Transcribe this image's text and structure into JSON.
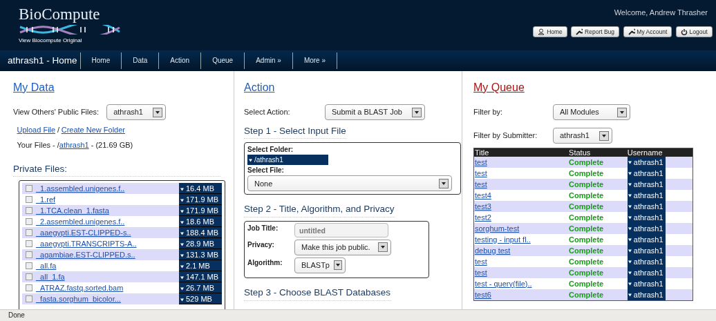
{
  "header": {
    "logo": "BioCompute",
    "original_link": "View Biocompute Original",
    "welcome": "Welcome, Andrew Thrasher",
    "buttons": [
      {
        "label": "Home",
        "kind": "home"
      },
      {
        "label": "Report Bug",
        "kind": "report"
      },
      {
        "label": "My Account",
        "kind": "account"
      },
      {
        "label": "Logout",
        "kind": "logout"
      }
    ]
  },
  "nav": {
    "title": "athrash1 - Home",
    "items": [
      "Home",
      "Data",
      "Action",
      "Queue",
      "Admin »",
      "More »"
    ]
  },
  "my_data": {
    "heading": "My Data",
    "view_label": "View Others' Public Files:",
    "view_value": "athrash1",
    "links": [
      "Upload File",
      "Create New Folder"
    ],
    "link_sep": "/",
    "files_prefix": "Your Files - /",
    "files_folder": "athrash1",
    "files_suffix": " - (21.69 GB)",
    "private_heading": "Private Files:",
    "files": [
      {
        "name": "_1.assembled.unigenes.f..",
        "size": "16.4 MB",
        "checked": false
      },
      {
        "name": "_1.ref",
        "size": "171.9 MB",
        "checked": false
      },
      {
        "name": "_1.TCA.clean_1.fasta",
        "size": "171.9 MB",
        "checked": false
      },
      {
        "name": "_2.assembled.unigenes.f..",
        "size": "18.6 MB",
        "checked": false
      },
      {
        "name": "_aaegypti.EST-CLIPPED-s..",
        "size": "188.4 MB",
        "checked": false
      },
      {
        "name": "_aaegypti.TRANSCRIPTS-A..",
        "size": "28.9 MB",
        "checked": false
      },
      {
        "name": "_agambiae.EST-CLIPPED.s..",
        "size": "131.3 MB",
        "checked": false
      },
      {
        "name": "_all.fa",
        "size": "2.1 MB",
        "checked": false
      },
      {
        "name": "_all_1.fa",
        "size": "147.1 MB",
        "checked": false
      },
      {
        "name": "_ATRAZ.fastq.sorted.bam",
        "size": "26.7 MB",
        "checked": false
      },
      {
        "name": "_fasta.sorghum_bicolor...",
        "size": "529 MB",
        "checked": false
      }
    ]
  },
  "action": {
    "heading": "Action",
    "select_label": "Select Action:",
    "select_value": "Submit a BLAST Job",
    "step1": {
      "heading": "Step 1 - Select Input File",
      "folder_label": "Select Folder:",
      "folder": "/athrash1",
      "file_label": "Select File:",
      "file_value": "None"
    },
    "step2": {
      "heading": "Step 2 - Title, Algorithm, and Privacy",
      "title_label": "Job Title:",
      "title_placeholder": "untitled",
      "privacy_label": "Privacy:",
      "privacy_value": "Make this job public.",
      "algorithm_label": "Algorithm:",
      "algorithm_value": "BLASTp"
    },
    "step3": {
      "heading": "Step 3 - Choose BLAST Databases"
    }
  },
  "queue": {
    "heading": "My Queue",
    "filter_label": "Filter by:",
    "filter_value": "All Modules",
    "submitter_label": "Filter by Submitter:",
    "submitter_value": "athrash1",
    "columns": [
      "Title",
      "Status",
      "Username"
    ],
    "rows": [
      {
        "title": "test",
        "status": "Complete",
        "user": "athrash1"
      },
      {
        "title": "test",
        "status": "Complete",
        "user": "athrash1"
      },
      {
        "title": "test",
        "status": "Complete",
        "user": "athrash1"
      },
      {
        "title": "test4",
        "status": "Complete",
        "user": "athrash1"
      },
      {
        "title": "test3",
        "status": "Complete",
        "user": "athrash1"
      },
      {
        "title": "test2",
        "status": "Complete",
        "user": "athrash1"
      },
      {
        "title": "sorghum-test",
        "status": "Complete",
        "user": "athrash1"
      },
      {
        "title": "testing - input fl..",
        "status": "Complete",
        "user": "athrash1"
      },
      {
        "title": "debug test",
        "status": "Complete",
        "user": "athrash1"
      },
      {
        "title": "test",
        "status": "Complete",
        "user": "athrash1"
      },
      {
        "title": "test",
        "status": "Complete",
        "user": "athrash1"
      },
      {
        "title": "test - query(file)..",
        "status": "Complete",
        "user": "athrash1"
      },
      {
        "title": "test6",
        "status": "Complete",
        "user": "athrash1"
      }
    ]
  },
  "status_bar": "Done"
}
